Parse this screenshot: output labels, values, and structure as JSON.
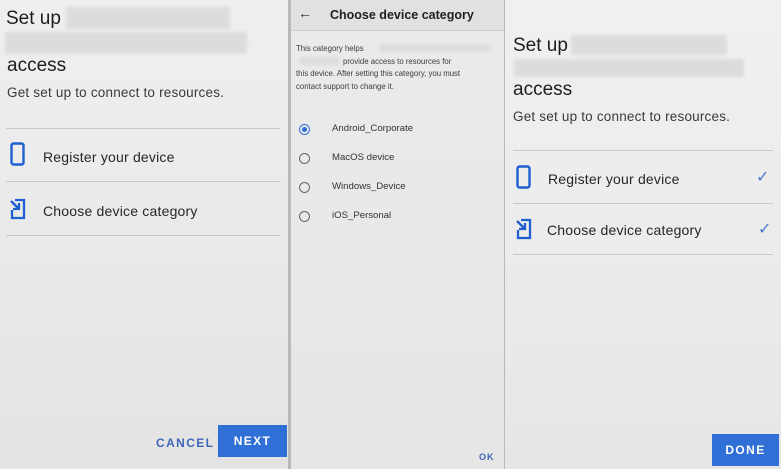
{
  "screen1": {
    "title_line1": "Set up",
    "title_line3": "access",
    "subtitle": "Get set up to connect to resources.",
    "items": [
      {
        "label": "Register your device",
        "icon": "phone-icon"
      },
      {
        "label": "Choose device category",
        "icon": "device-category-icon"
      }
    ],
    "cancel_label": "CANCEL",
    "next_label": "NEXT"
  },
  "screen2": {
    "title": "Choose device category",
    "desc_line1": "This category helps",
    "desc_line2": "provide access to resources for",
    "desc_line3": "this device. After setting this category, you must",
    "desc_line4": "contact support to change it.",
    "options": [
      {
        "label": "Android_Corporate",
        "selected": true
      },
      {
        "label": "MacOS device",
        "selected": false
      },
      {
        "label": "Windows_Device",
        "selected": false
      },
      {
        "label": "iOS_Personal",
        "selected": false
      }
    ],
    "ok_label": "OK"
  },
  "screen3": {
    "title_line1": "Set up",
    "title_line3": "access",
    "subtitle": "Get set up to connect to resources.",
    "items": [
      {
        "label": "Register your device",
        "icon": "phone-icon",
        "completed": true
      },
      {
        "label": "Choose device category",
        "icon": "device-category-icon",
        "completed": true
      }
    ],
    "done_label": "DONE"
  },
  "colors": {
    "accent": "#2f6fd6",
    "text_button": "#3f66b8",
    "icon_blue": "#1f5fd0"
  }
}
